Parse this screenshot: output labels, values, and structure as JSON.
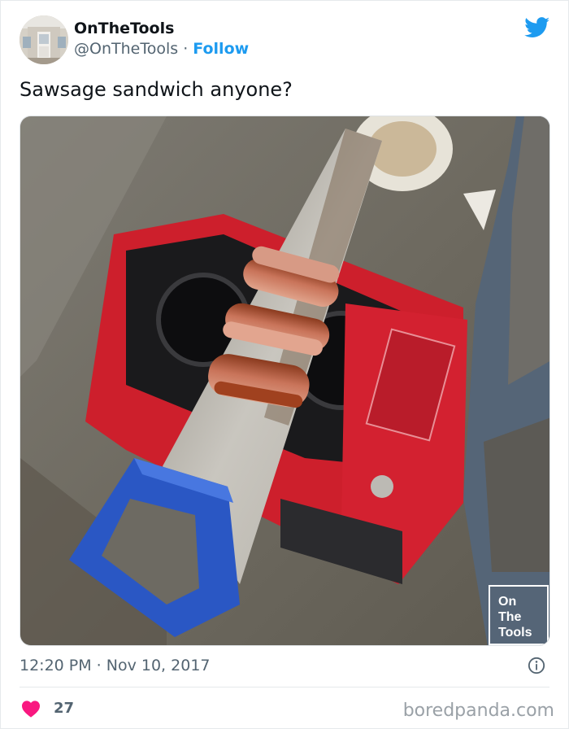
{
  "tweet": {
    "display_name": "OnTheTools",
    "handle": "@OnTheTools",
    "separator": "·",
    "follow_label": "Follow",
    "text": "Sawsage sandwich anyone?",
    "timestamp": "12:20 PM · Nov 10, 2017",
    "like_count": "27",
    "media_watermark": {
      "line1": "On",
      "line2": "The",
      "line3": "Tools"
    }
  },
  "icons": {
    "twitter": "twitter-bird-icon",
    "info": "info-icon",
    "heart": "heart-icon"
  },
  "colors": {
    "twitter_blue": "#1d9bf0",
    "like_red": "#f91880",
    "secondary_text": "#536471"
  },
  "footer": {
    "watermark": "boredpanda.com"
  }
}
